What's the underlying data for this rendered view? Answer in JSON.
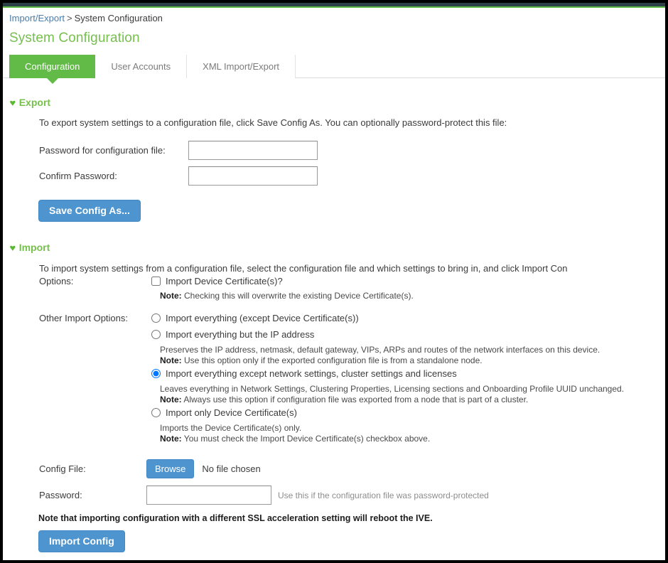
{
  "breadcrumb": {
    "parent": "Import/Export",
    "separator": ">",
    "current": "System Configuration"
  },
  "page": {
    "title": "System Configuration",
    "accent_green": "#62bb46",
    "title_green": "#76c04e",
    "button_blue": "#4e95cf",
    "link_blue": "#4a7ca8"
  },
  "tabs": [
    {
      "label": "Configuration",
      "active": true
    },
    {
      "label": "User Accounts",
      "active": false
    },
    {
      "label": "XML Import/Export",
      "active": false
    }
  ],
  "export": {
    "heading": "Export",
    "chevron": "♥",
    "intro": "To export system settings to a configuration file, click Save Config As. You can optionally password-protect this file:",
    "password_label": "Password for configuration file:",
    "password_value": "",
    "confirm_label": "Confirm Password:",
    "confirm_value": "",
    "save_button": "Save Config As..."
  },
  "import": {
    "heading": "Import",
    "chevron": "♥",
    "intro": "To import system settings from a configuration file, select the configuration file and which settings to bring in, and click Import Con",
    "options_label": "Options:",
    "device_cert_checkbox_label": "Import Device Certificate(s)?",
    "device_cert_checked": false,
    "device_cert_note_prefix": "Note:",
    "device_cert_note": "Checking this will overwrite the existing Device Certificate(s).",
    "other_options_label": "Other Import Options:",
    "radios": [
      {
        "label": "Import everything (except Device Certificate(s))",
        "selected": false,
        "desc": "",
        "note_prefix": "",
        "note": ""
      },
      {
        "label": "Import everything but the IP address",
        "selected": false,
        "desc": "Preserves the IP address, netmask, default gateway, VIPs, ARPs and routes of the network interfaces on this device.",
        "note_prefix": "Note:",
        "note": "Use this option only if the exported configuration file is from a standalone node."
      },
      {
        "label": "Import everything except network settings, cluster settings and licenses",
        "selected": true,
        "desc": "Leaves everything in Network Settings, Clustering Properties, Licensing sections and Onboarding Profile UUID unchanged.",
        "note_prefix": "Note:",
        "note": "Always use this option if configuration file was exported from a node that is part of a cluster."
      },
      {
        "label": "Import only Device Certificate(s)",
        "selected": false,
        "desc": "Imports the Device Certificate(s) only.",
        "note_prefix": "Note:",
        "note": "You must check the Import Device Certificate(s) checkbox above."
      }
    ],
    "config_file_label": "Config File:",
    "browse_button": "Browse",
    "no_file_text": "No file chosen",
    "password_label": "Password:",
    "password_value": "",
    "password_hint": "Use this if the configuration file was password-protected",
    "reboot_warning": "Note that importing configuration with a different SSL acceleration setting will reboot the IVE.",
    "import_button": "Import Config"
  }
}
